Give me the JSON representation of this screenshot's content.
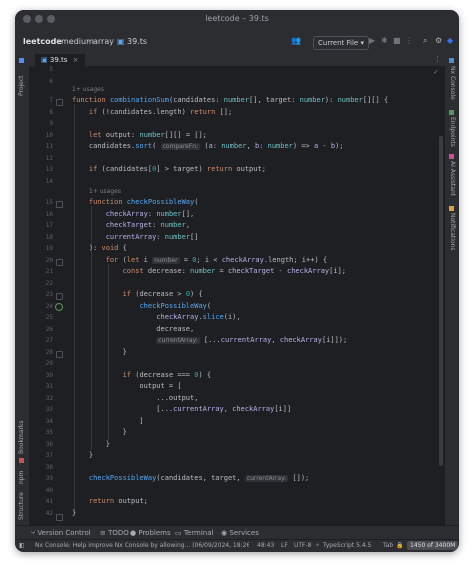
{
  "window": {
    "title": "leetcode – 39.ts"
  },
  "navbar": {
    "project": "leetcode",
    "crumbs": [
      "medium",
      "array"
    ],
    "file": "39.ts",
    "run_config": "Current File"
  },
  "tabs": [
    {
      "label": "39.ts"
    }
  ],
  "left_tools": {
    "project": "Project",
    "bookmarks": "Bookmarks",
    "npm": "npm",
    "structure": "Structure"
  },
  "right_tools": {
    "nx_console": "Nx Console",
    "endpoints": "Endpoints",
    "ai_assistant": "AI Assistant",
    "notifications": "Notifications"
  },
  "editor": {
    "line_numbers": [
      "5",
      "6",
      "7",
      "8",
      "9",
      "10",
      "11",
      "12",
      "13",
      "14",
      "15",
      "16",
      "17",
      "18",
      "19",
      "20",
      "21",
      "22",
      "23",
      "24",
      "25",
      "26",
      "27",
      "28",
      "29",
      "30",
      "31",
      "32",
      "33",
      "34",
      "35",
      "36",
      "37",
      "38",
      "39",
      "40",
      "41",
      "42"
    ],
    "usages_1": "1+ usages",
    "usages_2": "1+ usages",
    "hint_compareFn": "compareFn:",
    "hint_number": "number",
    "hint_currentArray_1": "currentArray:",
    "hint_currentArray_2": "currentArray:"
  },
  "bottom_tools": {
    "version_control": "Version Control",
    "todo": "TODO",
    "problems": "Problems",
    "terminal": "Terminal",
    "services": "Services"
  },
  "status": {
    "message": "Nx Console: Help improve Nx Console by allowing... (06/09/2024, 18:26",
    "position": "48:43",
    "line_sep": "LF",
    "encoding": "UTF-8",
    "language": "TypeScript 5.4.5",
    "indent": "Tab",
    "memory": "1450 of 3400M"
  },
  "colors": {
    "accent": "#3574f0",
    "keyword": "#cf8e6d",
    "function": "#56a8f5",
    "type": "#6ec0c6"
  }
}
